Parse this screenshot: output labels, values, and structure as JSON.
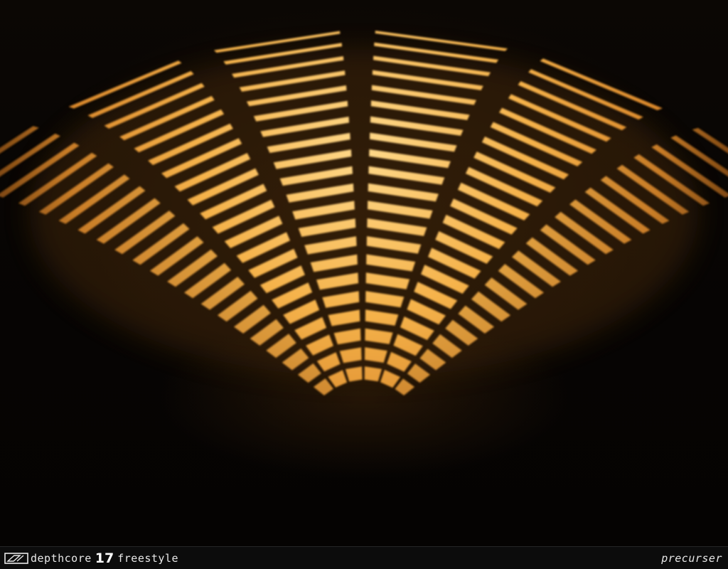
{
  "wallpaper": {
    "subject": "glowing-lamp-grid",
    "colors": {
      "glow_light": "#ffd27a",
      "glow_mid": "#f0a53c",
      "glow_dark": "#b86e1e",
      "background": "#060403",
      "footer": "#0c0c0c",
      "footer_text": "#e8e8e8"
    }
  },
  "footer": {
    "series": "depthcore",
    "issue": "17",
    "theme": "freestyle",
    "author": "precurser",
    "logo_icon": "depthcore-logo-icon"
  }
}
